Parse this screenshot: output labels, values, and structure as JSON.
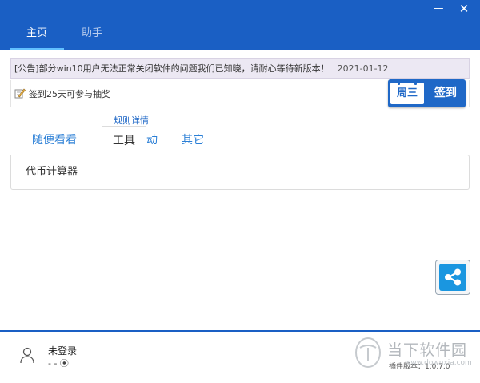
{
  "window": {
    "minimize_glyph": "—",
    "close_glyph": "✕"
  },
  "nav": {
    "tabs": [
      {
        "label": "主页",
        "active": true
      },
      {
        "label": "助手",
        "active": false
      }
    ]
  },
  "notice": {
    "text": "[公告]部分win10用户无法正常关闭软件的问题我们已知晓，请耐心等待新版本！",
    "date": "2021-01-12"
  },
  "signin": {
    "text": "签到25天可参与抽奖",
    "weekday": "周三",
    "button_label": "签到",
    "rules_link": "规则详情"
  },
  "tabs": [
    {
      "label": "随便看看",
      "active": false
    },
    {
      "label": "工具",
      "active": true
    },
    {
      "label": "活动",
      "active": false
    },
    {
      "label": "其它",
      "active": false
    }
  ],
  "tools": {
    "items": [
      "代币计算器"
    ]
  },
  "footer": {
    "login_status": "未登录",
    "points": "- - ⦿",
    "version": "插件版本：1.0.7.0"
  },
  "watermark": {
    "text": "当下软件园",
    "url": "www.downxia.com"
  },
  "colors": {
    "brand_blue": "#1a5fc4",
    "accent_blue": "#2b7fd6",
    "share_blue": "#1a96e0",
    "tab_indicator": "#62c0ff"
  }
}
